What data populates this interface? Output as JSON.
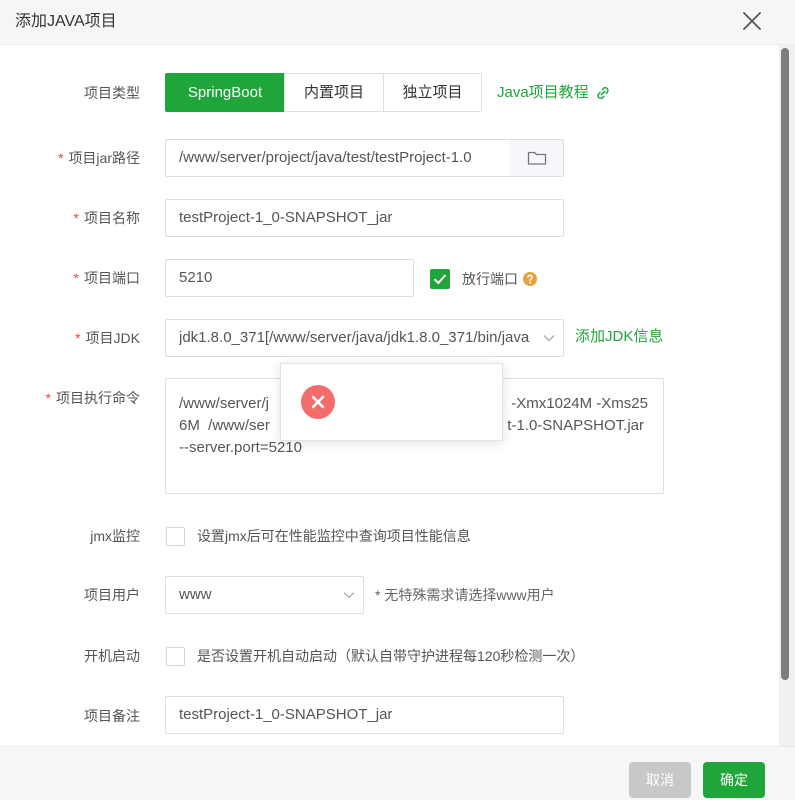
{
  "dialog": {
    "title": "添加JAVA项目",
    "close_icon": "close-icon"
  },
  "colors": {
    "primary": "#20a53a",
    "required": "#ef4444",
    "warning": "#e6a23c",
    "error": "#f56c6c",
    "disabled": "#c8c8c8"
  },
  "form": {
    "required_mark": "*",
    "project_type": {
      "label": "项目类型",
      "options": [
        "SpringBoot",
        "内置项目",
        "独立项目"
      ],
      "selected_index": 0,
      "tutorial_link": "Java项目教程",
      "tutorial_icon": "link-icon"
    },
    "jar_path": {
      "label": "项目jar路径",
      "value": "/www/server/project/java/test/testProject-1.0",
      "browse_icon": "folder-icon"
    },
    "name": {
      "label": "项目名称",
      "value": "testProject-1_0-SNAPSHOT_jar"
    },
    "port": {
      "label": "项目端口",
      "value": "5210",
      "open_port_checked": true,
      "open_port_label": "放行端口",
      "help_icon": "question-icon"
    },
    "jdk": {
      "label": "项目JDK",
      "selected": "jdk1.8.0_371[/www/server/java/jdk1.8.0_371/bin/java",
      "add_link": "添加JDK信息"
    },
    "command": {
      "label": "项目执行命令",
      "lines": [
        {
          "left": "/www/server/j",
          "right": "-Xmx1024M -Xms25"
        },
        {
          "left": "6M  /www/ser",
          "right": "t-1.0-SNAPSHOT.jar"
        },
        {
          "left": "--server.port=5210"
        }
      ]
    },
    "jmx": {
      "label": "jmx监控",
      "checked": false,
      "description": "设置jmx后可在性能监控中查询项目性能信息"
    },
    "user": {
      "label": "项目用户",
      "selected": "www",
      "hint": "* 无特殊需求请选择www用户"
    },
    "autostart": {
      "label": "开机启动",
      "checked": false,
      "description": "是否设置开机自动启动（默认自带守护进程每120秒检测一次）"
    },
    "remark": {
      "label": "项目备注",
      "value": "testProject-1_0-SNAPSHOT_jar"
    }
  },
  "error_toast": {
    "icon": "error-icon"
  },
  "footer": {
    "cancel_label": "取消",
    "confirm_label": "确定",
    "cancel_disabled": true
  }
}
